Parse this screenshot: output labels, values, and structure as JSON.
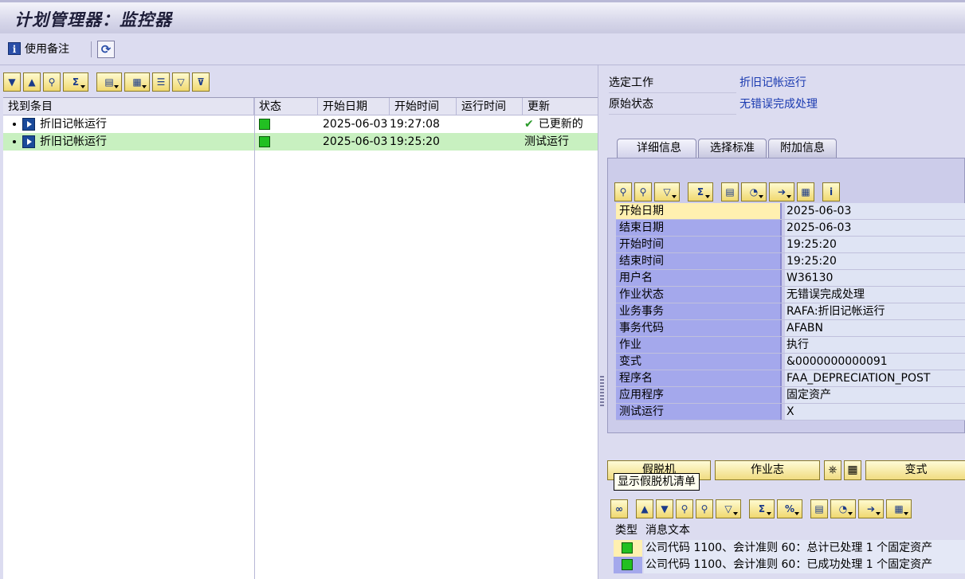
{
  "window": {
    "title": "计划管理器：监控器"
  },
  "app_toolbar": {
    "notes_label": "使用备注"
  },
  "tree": {
    "columns": [
      "找到条目",
      "状态",
      "开始日期",
      "开始时间",
      "运行时间",
      "更新"
    ],
    "rows": [
      {
        "name": "折旧记帐运行",
        "status": "green",
        "start_date": "2025-06-03",
        "start_time": "19:27:08",
        "run_time": "",
        "update": "已更新的",
        "update_check": "✔"
      },
      {
        "name": "折旧记帐运行",
        "status": "green",
        "start_date": "2025-06-03",
        "start_time": "19:25:20",
        "run_time": "",
        "update": "测试运行"
      }
    ]
  },
  "selection": {
    "job_label": "选定工作",
    "job_value": "折旧记帐运行",
    "orig_status_label": "原始状态",
    "orig_status_value": "无错误完成处理"
  },
  "tabs": [
    "详细信息",
    "选择标准",
    "附加信息"
  ],
  "details": [
    {
      "key": "开始日期",
      "value": "2025-06-03"
    },
    {
      "key": "结束日期",
      "value": "2025-06-03"
    },
    {
      "key": "开始时间",
      "value": "19:25:20"
    },
    {
      "key": "结束时间",
      "value": "19:25:20"
    },
    {
      "key": "用户名",
      "value": "W36130"
    },
    {
      "key": "作业状态",
      "value": "无错误完成处理"
    },
    {
      "key": "业务事务",
      "value": "RAFA:折旧记帐运行"
    },
    {
      "key": "事务代码",
      "value": "AFABN"
    },
    {
      "key": "作业",
      "value": "执行"
    },
    {
      "key": "变式",
      "value": "&0000000000091"
    },
    {
      "key": "程序名",
      "value": "FAA_DEPRECIATION_POST"
    },
    {
      "key": "应用程序",
      "value": "固定资产"
    },
    {
      "key": "测试运行",
      "value": "X"
    }
  ],
  "buttons": {
    "dummy_machine": "假脱机",
    "job_log": "作业志",
    "variant": "变式"
  },
  "tooltip": "显示假脱机清单",
  "messages": {
    "col_type": "类型",
    "col_text": "消息文本",
    "rows": [
      {
        "type": "green",
        "text": "公司代码 1100、会计准则 60：总计已处理 1 个固定资产"
      },
      {
        "type": "green",
        "text": "公司代码 1100、会计准则 60：已成功处理 1 个固定资产"
      }
    ]
  },
  "colors": {
    "title_bg": "#d7d7ea",
    "pane_bg": "#dcdcf0",
    "selected_row": "#c8f0c0",
    "link": "#1a3ab0",
    "status_green": "#22c022"
  }
}
